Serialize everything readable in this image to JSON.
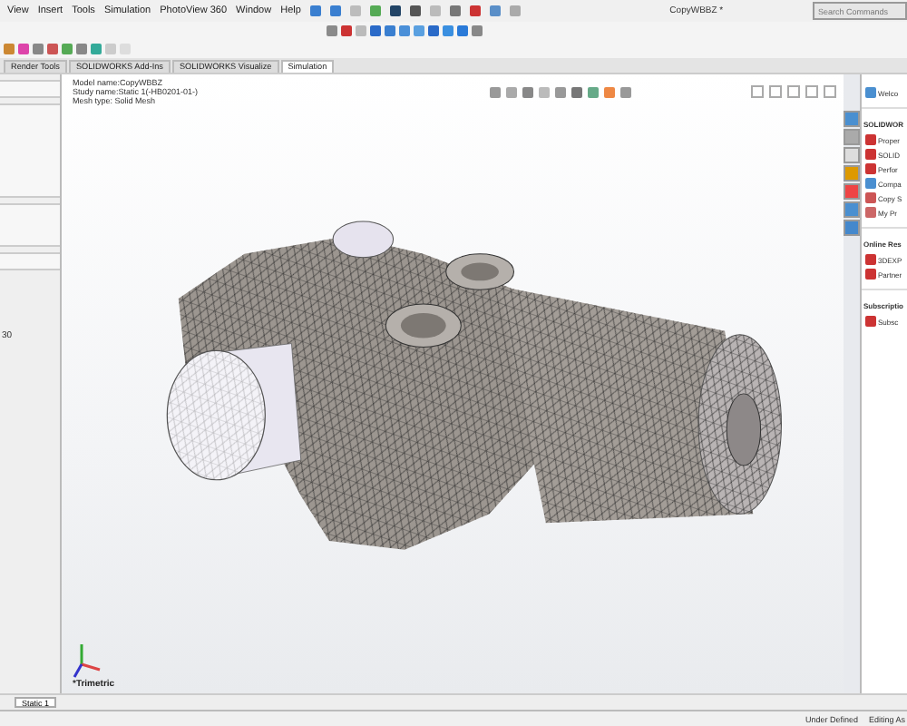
{
  "menu": [
    "View",
    "Insert",
    "Tools",
    "Simulation",
    "PhotoView 360",
    "Window",
    "Help"
  ],
  "title": "CopyWBBZ *",
  "search": {
    "placeholder": "Search Commands"
  },
  "tabs": [
    {
      "label": "Render Tools",
      "selected": false
    },
    {
      "label": "SOLIDWORKS Add-Ins",
      "selected": false
    },
    {
      "label": "SOLIDWORKS Visualize",
      "selected": false
    },
    {
      "label": "Simulation",
      "selected": true
    }
  ],
  "left_panel": {
    "value": "30"
  },
  "viewport": {
    "info": [
      "Model name:CopyWBBZ",
      "Study name:Static 1(-HB0201-01-)",
      "Mesh type: Solid Mesh"
    ],
    "view_label": "*Trimetric"
  },
  "task_pane": {
    "welcome": "Welco",
    "sections": [
      {
        "heading": "SOLIDWOR",
        "items": [
          "Proper",
          "SOLID",
          "Perfor",
          "Compa",
          "Copy S",
          "My Pr"
        ]
      },
      {
        "heading": "Online Res",
        "items": [
          "3DEXP",
          "Partner"
        ]
      },
      {
        "heading": "Subscriptio",
        "items": [
          "Subsc"
        ]
      }
    ]
  },
  "bottom_tab": "Static 1",
  "status_bar": [
    "Under Defined",
    "Editing As"
  ]
}
